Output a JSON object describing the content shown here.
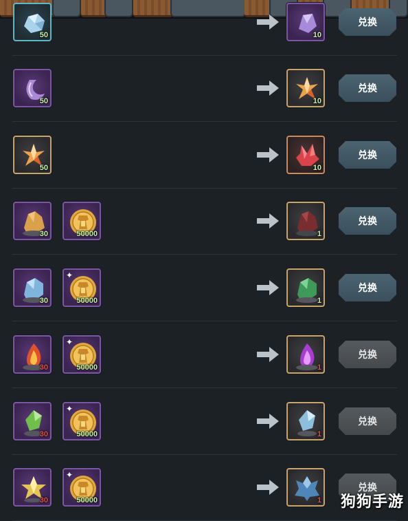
{
  "exchange_button_label": "兑换",
  "watermark": "狗狗手游",
  "rows": [
    {
      "inputs": [
        {
          "icon": "blue-ore-icon",
          "count": "50",
          "frame": "cyan"
        }
      ],
      "output": {
        "icon": "purple-crystal-icon",
        "count": "10",
        "frame": "purple"
      },
      "button_state": "active"
    },
    {
      "inputs": [
        {
          "icon": "purple-crescent-crystal-icon",
          "count": "50",
          "frame": "purple"
        }
      ],
      "output": {
        "icon": "orange-star-crystal-icon",
        "count": "10",
        "frame": "gold"
      },
      "button_state": "active"
    },
    {
      "inputs": [
        {
          "icon": "orange-star-crystal-icon",
          "count": "50",
          "frame": "gold"
        }
      ],
      "output": {
        "icon": "red-crystal-icon",
        "count": "10",
        "frame": "gold-red"
      },
      "button_state": "active"
    },
    {
      "inputs": [
        {
          "icon": "orange-rock-ore-icon",
          "count": "30",
          "frame": "purple"
        },
        {
          "icon": "gold-coin-icon",
          "count": "50000",
          "frame": "purple"
        }
      ],
      "output": {
        "icon": "dark-red-rock-ore-icon",
        "count": "1",
        "frame": "gold"
      },
      "button_state": "active"
    },
    {
      "inputs": [
        {
          "icon": "blue-rock-ore-icon",
          "count": "30",
          "frame": "purple"
        },
        {
          "icon": "gold-coin-icon",
          "count": "50000",
          "frame": "purple",
          "starred": true
        }
      ],
      "output": {
        "icon": "green-rock-ore-icon",
        "count": "1",
        "frame": "gold"
      },
      "button_state": "active"
    },
    {
      "inputs": [
        {
          "icon": "fire-ore-icon",
          "count": "30",
          "frame": "purple",
          "count_color": "red"
        },
        {
          "icon": "gold-coin-icon",
          "count": "50000",
          "frame": "purple",
          "starred": true
        }
      ],
      "output": {
        "icon": "purple-fire-ore-icon",
        "count": "1",
        "frame": "gold",
        "count_color": "red"
      },
      "button_state": "disabled"
    },
    {
      "inputs": [
        {
          "icon": "green-shard-ore-icon",
          "count": "30",
          "frame": "purple",
          "count_color": "red"
        },
        {
          "icon": "gold-coin-icon",
          "count": "50000",
          "frame": "purple",
          "starred": true
        }
      ],
      "output": {
        "icon": "blue-shard-ore-icon",
        "count": "1",
        "frame": "gold",
        "count_color": "red"
      },
      "button_state": "disabled"
    },
    {
      "inputs": [
        {
          "icon": "gold-star-ore-icon",
          "count": "30",
          "frame": "purple",
          "count_color": "red"
        },
        {
          "icon": "gold-coin-icon",
          "count": "50000",
          "frame": "purple",
          "starred": true
        }
      ],
      "output": {
        "icon": "blue-star-ore-icon",
        "count": "1",
        "frame": "gold",
        "count_color": "red"
      },
      "button_state": "disabled"
    }
  ],
  "colors": {
    "background": "#1c2125",
    "active_button": "#4b6470",
    "disabled_button": "#555a5e",
    "count_green": "#c7f0a8",
    "count_red": "#e05050"
  }
}
